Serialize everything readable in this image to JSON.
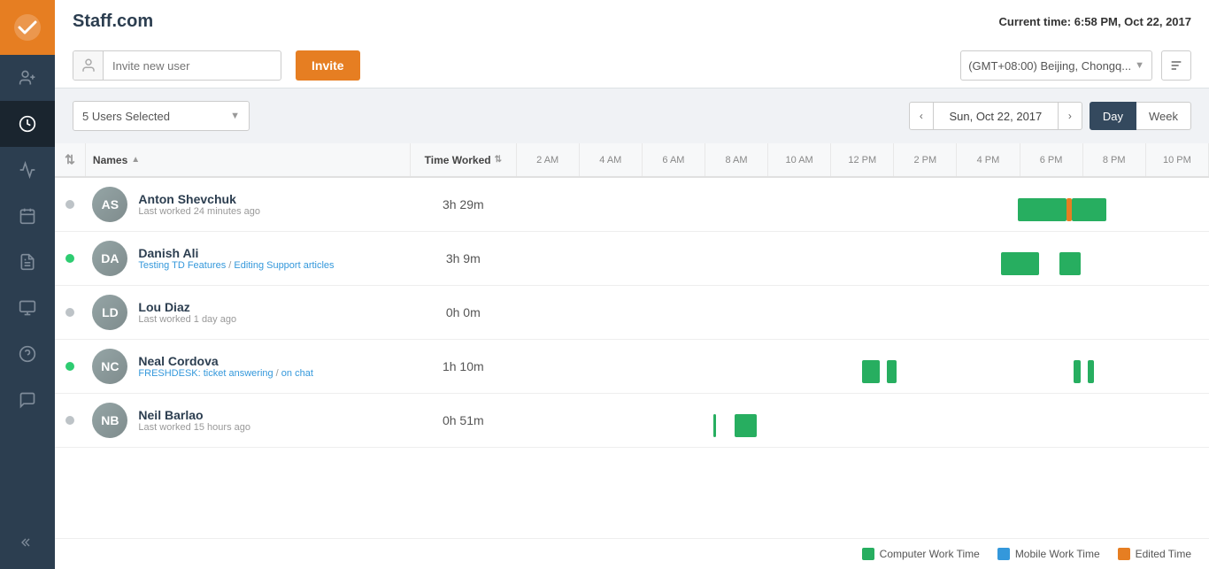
{
  "app": {
    "title": "Staff.com",
    "logo_icon": "check-icon"
  },
  "header": {
    "current_time_label": "Current time:",
    "current_time_value": "6:58 PM, Oct 22, 2017",
    "invite_placeholder": "Invite new user",
    "invite_button": "Invite",
    "timezone": "(GMT+08:00) Beijing, Chongq..."
  },
  "controls": {
    "users_selected": "5 Users Selected",
    "date": "Sun, Oct 22, 2017",
    "view_day": "Day",
    "view_week": "Week"
  },
  "table": {
    "col_names": "Names",
    "col_time_worked": "Time Worked",
    "hours": [
      "2 AM",
      "4 AM",
      "6 AM",
      "8 AM",
      "10 AM",
      "12 PM",
      "2 PM",
      "4 PM",
      "6 PM",
      "8 PM",
      "10 PM"
    ],
    "rows": [
      {
        "name": "Anton Shevchuk",
        "sub": "Last worked 24 minutes ago",
        "sub_type": "text",
        "online": false,
        "time_worked": "3h 29m",
        "avatar_initials": "AS",
        "bars": [
          {
            "type": "green",
            "left_pct": 72.5,
            "width_pct": 7.0
          },
          {
            "type": "orange",
            "left_pct": 79.5,
            "width_pct": 0.8
          },
          {
            "type": "green",
            "left_pct": 80.3,
            "width_pct": 5.0
          }
        ]
      },
      {
        "name": "Danish Ali",
        "sub": "Testing TD Features / Editing Support articles",
        "sub_type": "links",
        "online": true,
        "time_worked": "3h 9m",
        "avatar_initials": "DA",
        "bars": [
          {
            "type": "green",
            "left_pct": 70.0,
            "width_pct": 5.5
          },
          {
            "type": "green",
            "left_pct": 78.5,
            "width_pct": 3.0
          }
        ]
      },
      {
        "name": "Lou Diaz",
        "sub": "Last worked 1 day ago",
        "sub_type": "text",
        "online": false,
        "time_worked": "0h 0m",
        "avatar_initials": "LD",
        "bars": []
      },
      {
        "name": "Neal Cordova",
        "sub": "FRESHDESK: ticket answering / on chat",
        "sub_type": "links",
        "online": true,
        "time_worked": "1h 10m",
        "avatar_initials": "NC",
        "bars": [
          {
            "type": "green",
            "left_pct": 50.0,
            "width_pct": 2.5
          },
          {
            "type": "green",
            "left_pct": 53.5,
            "width_pct": 1.5
          },
          {
            "type": "green",
            "left_pct": 80.5,
            "width_pct": 1.0
          },
          {
            "type": "green",
            "left_pct": 82.5,
            "width_pct": 1.0
          }
        ]
      },
      {
        "name": "Neil Barlao",
        "sub": "Last worked 15 hours ago",
        "sub_type": "text",
        "online": false,
        "time_worked": "0h 51m",
        "avatar_initials": "NB",
        "bars": [
          {
            "type": "green",
            "left_pct": 28.5,
            "width_pct": 0.4
          },
          {
            "type": "green",
            "left_pct": 31.5,
            "width_pct": 3.2
          }
        ]
      }
    ]
  },
  "legend": {
    "computer_label": "Computer Work Time",
    "computer_color": "#27ae60",
    "mobile_label": "Mobile Work Time",
    "mobile_color": "#3498db",
    "edited_label": "Edited Time",
    "edited_color": "#e67e22"
  },
  "sidebar": {
    "items": [
      {
        "name": "add-user-icon",
        "icon": "👤+"
      },
      {
        "name": "refresh-icon",
        "icon": "↺"
      },
      {
        "name": "clock-icon",
        "icon": "⏱"
      },
      {
        "name": "calendar-icon",
        "icon": "📅"
      },
      {
        "name": "list-icon",
        "icon": "☰"
      },
      {
        "name": "card-icon",
        "icon": "▭"
      },
      {
        "name": "help-icon",
        "icon": "?"
      },
      {
        "name": "chat-icon",
        "icon": "💬"
      }
    ],
    "expand_icon": "<<"
  }
}
